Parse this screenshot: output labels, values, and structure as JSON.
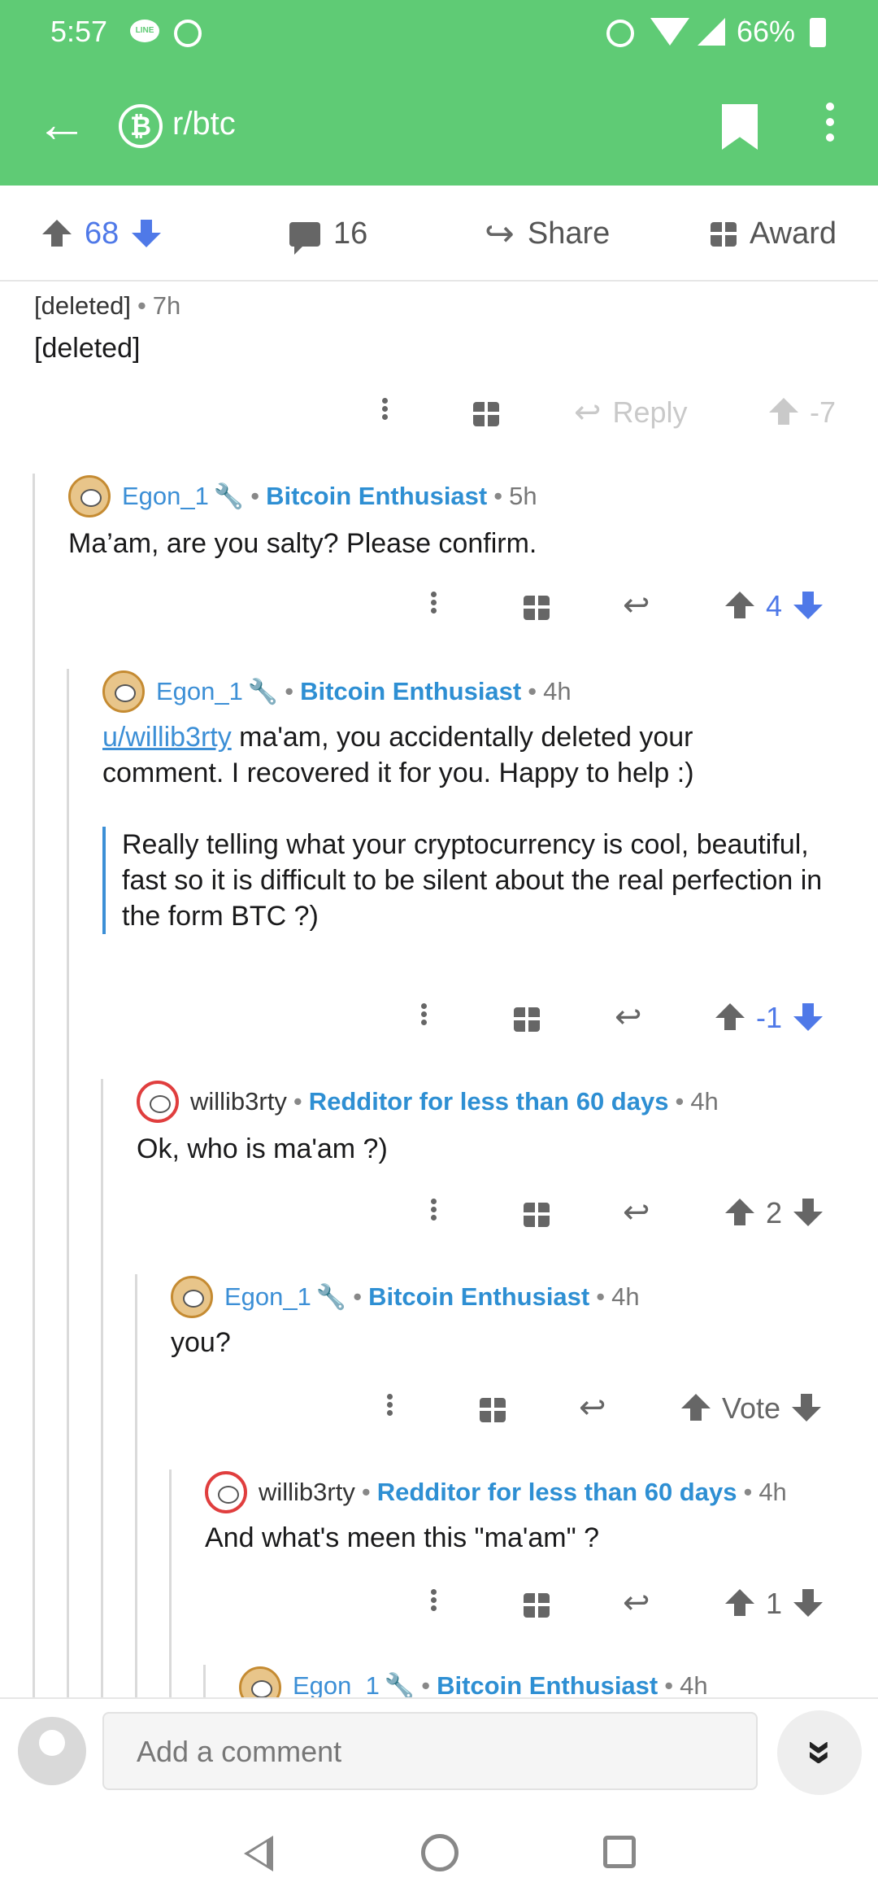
{
  "status_bar": {
    "time": "5:57",
    "line_badge": "LINE",
    "battery": "66%"
  },
  "app_bar": {
    "subreddit": "r/btc",
    "subreddit_icon": "₿"
  },
  "post_bar": {
    "votes": "68",
    "comments": "16",
    "share": "Share",
    "award": "Award"
  },
  "comments": [
    {
      "author": "[deleted]",
      "time": "7h",
      "body": "[deleted]",
      "actions": {
        "reply": "Reply",
        "score": "-7"
      }
    },
    {
      "author": "Egon_1",
      "flair": "Bitcoin Enthusiast",
      "time": "5h",
      "body": "Ma’am, are you salty? Please confirm.",
      "score": "4"
    },
    {
      "author": "Egon_1",
      "flair": "Bitcoin Enthusiast",
      "time": "4h",
      "body_link": "u/willib3rty",
      "body_rest": " ma'am, you accidentally deleted your comment. I recovered it for you. Happy to help :)",
      "quote": "Really telling what your cryptocurrency is cool, beautiful, fast so it is difficult to be silent about the real perfection in the form BTC ?)",
      "score": "-1"
    },
    {
      "author": "willib3rty",
      "flair": "Redditor for less than 60 days",
      "time": "4h",
      "body": "Ok, who is ma'am ?)",
      "score": "2"
    },
    {
      "author": "Egon_1",
      "flair": "Bitcoin Enthusiast",
      "time": "4h",
      "body": "you?",
      "score": "Vote"
    },
    {
      "author": "willib3rty",
      "flair": "Redditor for less than 60 days",
      "time": "4h",
      "body": "And what's meen this \"ma'am\" ?",
      "score": "1"
    },
    {
      "author": "Egon_1",
      "flair": "Bitcoin Enthusiast",
      "time": "4h"
    }
  ],
  "composer": {
    "placeholder": "Add a comment"
  }
}
